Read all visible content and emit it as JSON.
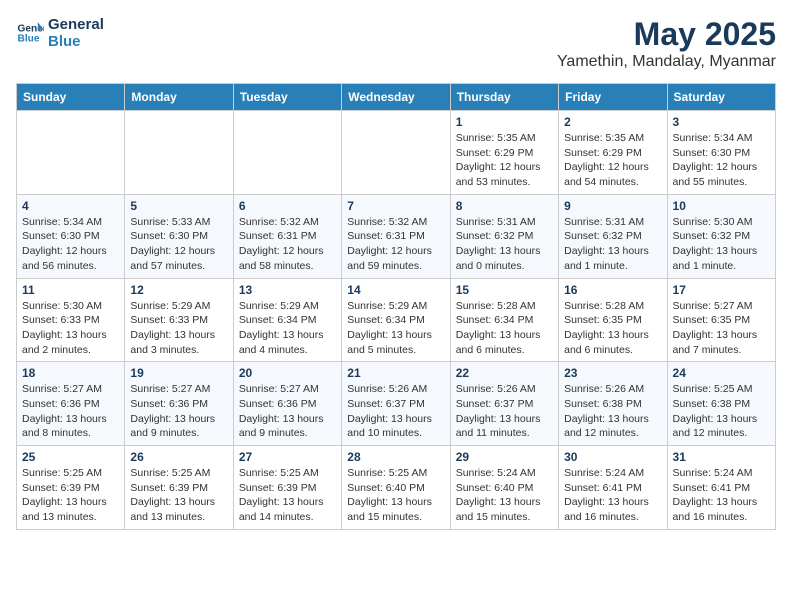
{
  "header": {
    "logo_line1": "General",
    "logo_line2": "Blue",
    "month": "May 2025",
    "location": "Yamethin, Mandalay, Myanmar"
  },
  "weekdays": [
    "Sunday",
    "Monday",
    "Tuesday",
    "Wednesday",
    "Thursday",
    "Friday",
    "Saturday"
  ],
  "weeks": [
    [
      {
        "day": "",
        "info": ""
      },
      {
        "day": "",
        "info": ""
      },
      {
        "day": "",
        "info": ""
      },
      {
        "day": "",
        "info": ""
      },
      {
        "day": "1",
        "info": "Sunrise: 5:35 AM\nSunset: 6:29 PM\nDaylight: 12 hours\nand 53 minutes."
      },
      {
        "day": "2",
        "info": "Sunrise: 5:35 AM\nSunset: 6:29 PM\nDaylight: 12 hours\nand 54 minutes."
      },
      {
        "day": "3",
        "info": "Sunrise: 5:34 AM\nSunset: 6:30 PM\nDaylight: 12 hours\nand 55 minutes."
      }
    ],
    [
      {
        "day": "4",
        "info": "Sunrise: 5:34 AM\nSunset: 6:30 PM\nDaylight: 12 hours\nand 56 minutes."
      },
      {
        "day": "5",
        "info": "Sunrise: 5:33 AM\nSunset: 6:30 PM\nDaylight: 12 hours\nand 57 minutes."
      },
      {
        "day": "6",
        "info": "Sunrise: 5:32 AM\nSunset: 6:31 PM\nDaylight: 12 hours\nand 58 minutes."
      },
      {
        "day": "7",
        "info": "Sunrise: 5:32 AM\nSunset: 6:31 PM\nDaylight: 12 hours\nand 59 minutes."
      },
      {
        "day": "8",
        "info": "Sunrise: 5:31 AM\nSunset: 6:32 PM\nDaylight: 13 hours\nand 0 minutes."
      },
      {
        "day": "9",
        "info": "Sunrise: 5:31 AM\nSunset: 6:32 PM\nDaylight: 13 hours\nand 1 minute."
      },
      {
        "day": "10",
        "info": "Sunrise: 5:30 AM\nSunset: 6:32 PM\nDaylight: 13 hours\nand 1 minute."
      }
    ],
    [
      {
        "day": "11",
        "info": "Sunrise: 5:30 AM\nSunset: 6:33 PM\nDaylight: 13 hours\nand 2 minutes."
      },
      {
        "day": "12",
        "info": "Sunrise: 5:29 AM\nSunset: 6:33 PM\nDaylight: 13 hours\nand 3 minutes."
      },
      {
        "day": "13",
        "info": "Sunrise: 5:29 AM\nSunset: 6:34 PM\nDaylight: 13 hours\nand 4 minutes."
      },
      {
        "day": "14",
        "info": "Sunrise: 5:29 AM\nSunset: 6:34 PM\nDaylight: 13 hours\nand 5 minutes."
      },
      {
        "day": "15",
        "info": "Sunrise: 5:28 AM\nSunset: 6:34 PM\nDaylight: 13 hours\nand 6 minutes."
      },
      {
        "day": "16",
        "info": "Sunrise: 5:28 AM\nSunset: 6:35 PM\nDaylight: 13 hours\nand 6 minutes."
      },
      {
        "day": "17",
        "info": "Sunrise: 5:27 AM\nSunset: 6:35 PM\nDaylight: 13 hours\nand 7 minutes."
      }
    ],
    [
      {
        "day": "18",
        "info": "Sunrise: 5:27 AM\nSunset: 6:36 PM\nDaylight: 13 hours\nand 8 minutes."
      },
      {
        "day": "19",
        "info": "Sunrise: 5:27 AM\nSunset: 6:36 PM\nDaylight: 13 hours\nand 9 minutes."
      },
      {
        "day": "20",
        "info": "Sunrise: 5:27 AM\nSunset: 6:36 PM\nDaylight: 13 hours\nand 9 minutes."
      },
      {
        "day": "21",
        "info": "Sunrise: 5:26 AM\nSunset: 6:37 PM\nDaylight: 13 hours\nand 10 minutes."
      },
      {
        "day": "22",
        "info": "Sunrise: 5:26 AM\nSunset: 6:37 PM\nDaylight: 13 hours\nand 11 minutes."
      },
      {
        "day": "23",
        "info": "Sunrise: 5:26 AM\nSunset: 6:38 PM\nDaylight: 13 hours\nand 12 minutes."
      },
      {
        "day": "24",
        "info": "Sunrise: 5:25 AM\nSunset: 6:38 PM\nDaylight: 13 hours\nand 12 minutes."
      }
    ],
    [
      {
        "day": "25",
        "info": "Sunrise: 5:25 AM\nSunset: 6:39 PM\nDaylight: 13 hours\nand 13 minutes."
      },
      {
        "day": "26",
        "info": "Sunrise: 5:25 AM\nSunset: 6:39 PM\nDaylight: 13 hours\nand 13 minutes."
      },
      {
        "day": "27",
        "info": "Sunrise: 5:25 AM\nSunset: 6:39 PM\nDaylight: 13 hours\nand 14 minutes."
      },
      {
        "day": "28",
        "info": "Sunrise: 5:25 AM\nSunset: 6:40 PM\nDaylight: 13 hours\nand 15 minutes."
      },
      {
        "day": "29",
        "info": "Sunrise: 5:24 AM\nSunset: 6:40 PM\nDaylight: 13 hours\nand 15 minutes."
      },
      {
        "day": "30",
        "info": "Sunrise: 5:24 AM\nSunset: 6:41 PM\nDaylight: 13 hours\nand 16 minutes."
      },
      {
        "day": "31",
        "info": "Sunrise: 5:24 AM\nSunset: 6:41 PM\nDaylight: 13 hours\nand 16 minutes."
      }
    ]
  ]
}
